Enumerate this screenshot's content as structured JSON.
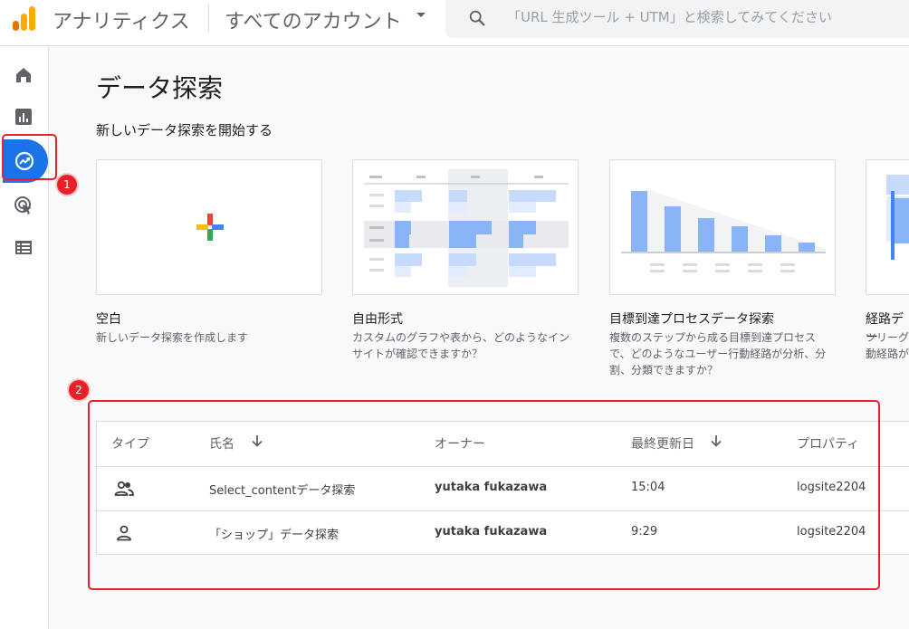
{
  "header": {
    "app_title": "アナリティクス",
    "account_label": "すべてのアカウント",
    "search_placeholder": "「URL 生成ツール + UTM」と検索してみてください"
  },
  "sidebar": {
    "items": [
      {
        "name": "home",
        "icon": "home-icon"
      },
      {
        "name": "reports",
        "icon": "bar-chart-icon"
      },
      {
        "name": "explore",
        "icon": "explore-icon",
        "active": true
      },
      {
        "name": "advertising",
        "icon": "cursor-target-icon"
      },
      {
        "name": "configure",
        "icon": "list-icon"
      }
    ]
  },
  "annotations": {
    "badge1": "1",
    "badge2": "2"
  },
  "main": {
    "title": "データ探索",
    "new_section_label": "新しいデータ探索を開始する",
    "templates": [
      {
        "title": "空白",
        "desc": "新しいデータ探索を作成します"
      },
      {
        "title": "自由形式",
        "desc": "カスタムのグラフや表から、どのようなインサイトが確認できますか？"
      },
      {
        "title": "目標到達プロセスデータ探索",
        "desc": "複数のステップから成る目標到達プロセスで、どのようなユーザー行動経路が分析、分割、分類できますか？"
      },
      {
        "title": "経路デー",
        "desc": "ツリーグ\n動経路が"
      }
    ],
    "table": {
      "headers": {
        "type": "タイプ",
        "name": "氏名",
        "owner": "オーナー",
        "modified": "最終更新日",
        "property": "プロパティ"
      },
      "rows": [
        {
          "type_icon": "group-icon",
          "name": "Select_contentデータ探索",
          "owner": "yutaka fukazawa",
          "modified": "15:04",
          "property": "logsite2204"
        },
        {
          "type_icon": "person-icon",
          "name": "「ショップ」データ探索",
          "owner": "yutaka fukazawa",
          "modified": "9:29",
          "property": "logsite2204"
        }
      ]
    }
  },
  "colors": {
    "accent": "#1a73e8",
    "annotation_red": "#e8202a",
    "chart_blue": "#8ab4f8",
    "logo_orange": "#f9ab00",
    "logo_dark_orange": "#e37400"
  }
}
